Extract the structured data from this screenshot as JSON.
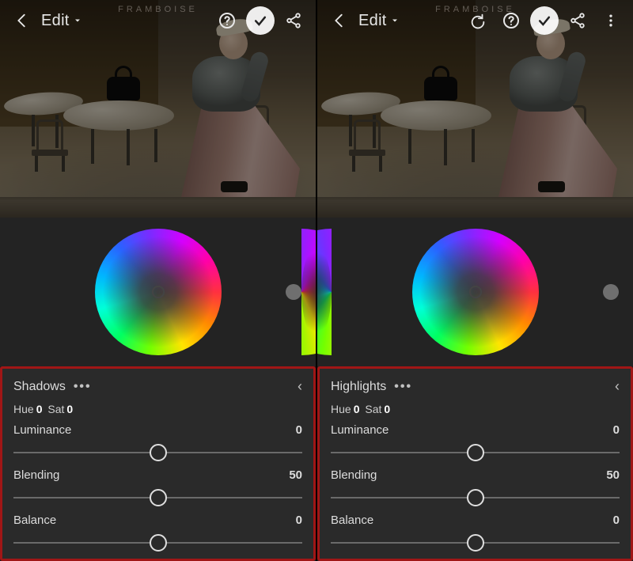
{
  "app": {
    "edit_label": "Edit",
    "watermark": "FRAMBOISE"
  },
  "icons": {
    "back": "←",
    "dropdown": "▾",
    "redo": "↻",
    "help": "?",
    "confirm": "✓",
    "share": "share",
    "more": "⋮",
    "collapse": "‹",
    "options": "•••"
  },
  "left": {
    "section_title": "Shadows",
    "hue_label": "Hue",
    "hue_value": "0",
    "sat_label": "Sat",
    "sat_value": "0",
    "sliders": [
      {
        "label": "Luminance",
        "value": "0",
        "pos": 50
      },
      {
        "label": "Blending",
        "value": "50",
        "pos": 50
      },
      {
        "label": "Balance",
        "value": "0",
        "pos": 50
      }
    ]
  },
  "right": {
    "section_title": "Highlights",
    "hue_label": "Hue",
    "hue_value": "0",
    "sat_label": "Sat",
    "sat_value": "0",
    "sliders": [
      {
        "label": "Luminance",
        "value": "0",
        "pos": 50
      },
      {
        "label": "Blending",
        "value": "50",
        "pos": 50
      },
      {
        "label": "Balance",
        "value": "0",
        "pos": 50
      }
    ]
  }
}
